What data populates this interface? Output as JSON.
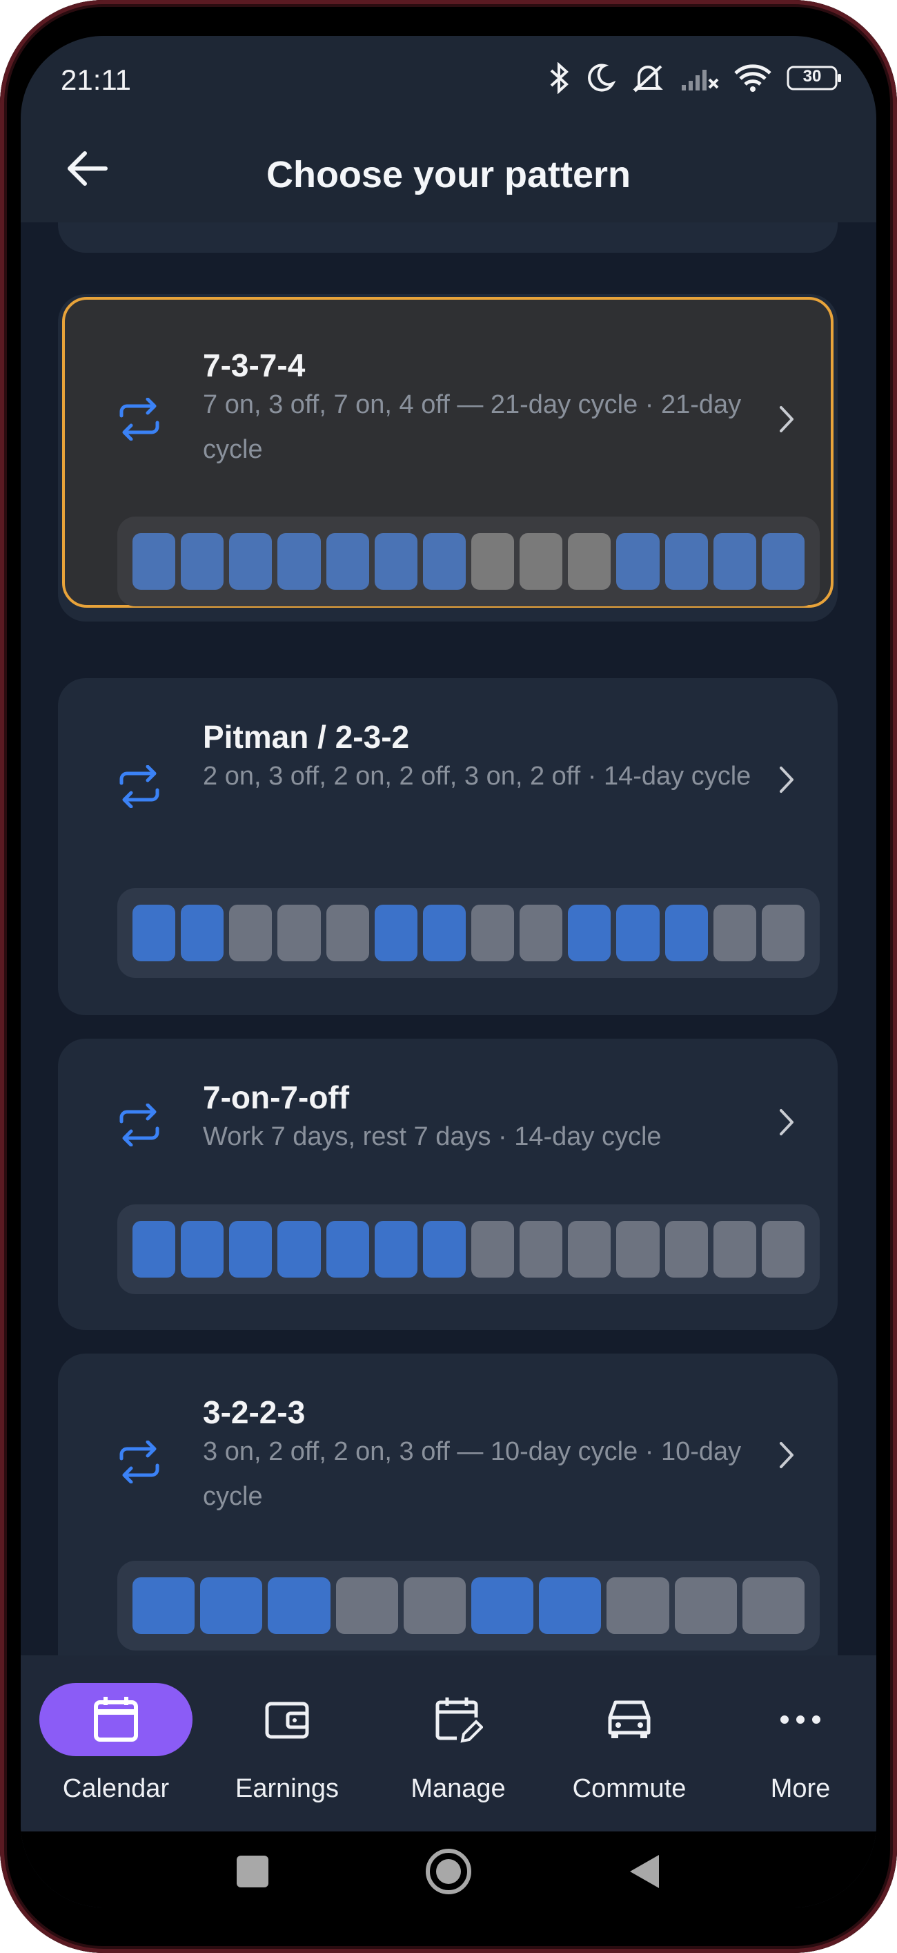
{
  "status_bar": {
    "time": "21:11",
    "battery": "30",
    "icons": [
      "bluetooth-icon",
      "moon-icon",
      "mute-icon",
      "signal-icon",
      "wifi-icon",
      "battery-icon"
    ]
  },
  "app_bar": {
    "title": "Choose your pattern",
    "back_icon": "arrow-left-icon"
  },
  "colors": {
    "accent_selected_border": "#e8a33a",
    "work_day": "#3c72c9",
    "off_day": "#6d7380",
    "nav_active": "#8b5cf6"
  },
  "patterns": [
    {
      "title": "7-3-7-4",
      "subtitle": "7 on, 3 off, 7 on, 4 off — 21-day cycle · 21-day cycle",
      "selected": true,
      "days": [
        1,
        1,
        1,
        1,
        1,
        1,
        1,
        0,
        0,
        0,
        1,
        1,
        1,
        1
      ]
    },
    {
      "title": "Pitman / 2-3-2",
      "subtitle": "2 on, 3 off, 2 on, 2 off, 3 on, 2 off · 14-day cycle",
      "selected": false,
      "days": [
        1,
        1,
        0,
        0,
        0,
        1,
        1,
        0,
        0,
        1,
        1,
        1,
        0,
        0
      ]
    },
    {
      "title": "7-on-7-off",
      "subtitle": "Work 7 days, rest 7 days · 14-day cycle",
      "selected": false,
      "days": [
        1,
        1,
        1,
        1,
        1,
        1,
        1,
        0,
        0,
        0,
        0,
        0,
        0,
        0
      ]
    },
    {
      "title": "3-2-2-3",
      "subtitle": "3 on, 2 off, 2 on, 3 off — 10-day cycle · 10-day cycle",
      "selected": false,
      "days": [
        1,
        1,
        1,
        0,
        0,
        1,
        1,
        0,
        0,
        0
      ]
    }
  ],
  "bottom_nav": {
    "items": [
      {
        "label": "Calendar",
        "icon": "calendar-icon",
        "active": true
      },
      {
        "label": "Earnings",
        "icon": "wallet-icon",
        "active": false
      },
      {
        "label": "Manage",
        "icon": "calendar-edit-icon",
        "active": false
      },
      {
        "label": "Commute",
        "icon": "car-icon",
        "active": false
      },
      {
        "label": "More",
        "icon": "more-dots-icon",
        "active": false
      }
    ]
  },
  "system_nav": [
    "square-icon",
    "circle-home-icon",
    "triangle-back-icon"
  ]
}
